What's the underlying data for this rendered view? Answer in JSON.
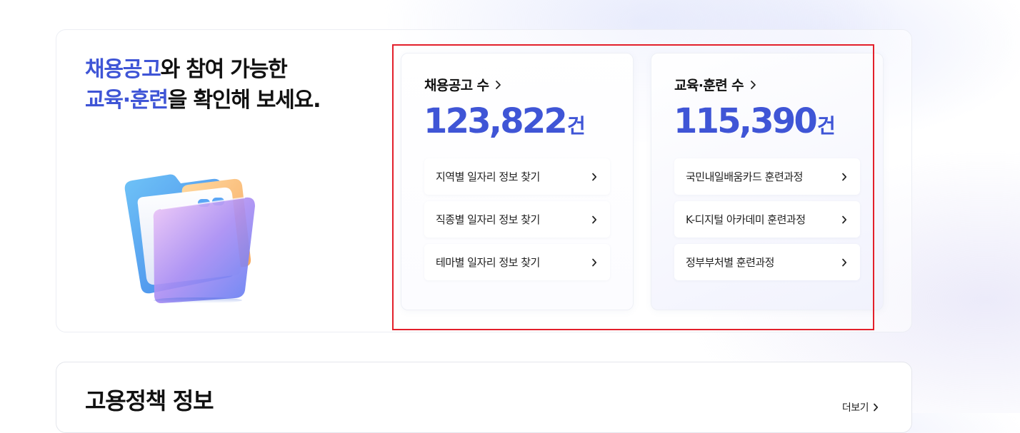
{
  "hero": {
    "title": {
      "line1_accent": "채용공고",
      "line1_rest": "와 참여 가능한",
      "line2_accent": "교육·훈련",
      "line2_rest": "을 확인해 보세요."
    },
    "illustration_icon": "folder-icon"
  },
  "jobs_card": {
    "label": "채용공고 수",
    "count": "123,822",
    "unit": "건",
    "links": [
      {
        "label": "지역별 일자리 정보 찾기"
      },
      {
        "label": "직종별 일자리 정보 찾기"
      },
      {
        "label": "테마별 일자리 정보 찾기"
      }
    ]
  },
  "edu_card": {
    "label": "교육·훈련 수",
    "count": "115,390",
    "unit": "건",
    "links": [
      {
        "label": "국민내일배움카드 훈련과정"
      },
      {
        "label": "K-디지털 아카데미 훈련과정"
      },
      {
        "label": "정부부처별 훈련과정"
      }
    ]
  },
  "policy": {
    "title": "고용정책 정보",
    "more_label": "더보기"
  },
  "colors": {
    "accent": "#3f55d6",
    "highlight": "#e3202b",
    "text": "#111111"
  }
}
